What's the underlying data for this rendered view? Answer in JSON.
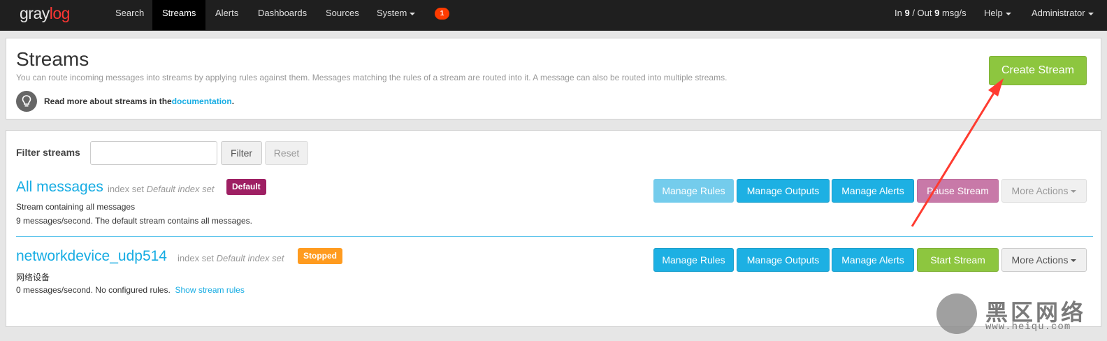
{
  "navbar": {
    "logo": {
      "part1": "gray",
      "part2": "log"
    },
    "items": [
      "Search",
      "Streams",
      "Alerts",
      "Dashboards",
      "Sources",
      "System"
    ],
    "notification_count": "1",
    "throughput": {
      "prefix": "In ",
      "in_value": "9",
      "mid": " / Out ",
      "out_value": "9",
      "suffix": " msg/s"
    },
    "help": "Help",
    "user": "Administrator"
  },
  "header": {
    "title": "Streams",
    "description": "You can route incoming messages into streams by applying rules against them. Messages matching the rules of a stream are routed into it. A message can also be routed into multiple streams.",
    "doc_hint_prefix": "Read more about streams in the ",
    "doc_link": "documentation",
    "doc_hint_suffix": ".",
    "create_button": "Create Stream"
  },
  "filter": {
    "label": "Filter streams",
    "value": "",
    "filter_button": "Filter",
    "reset_button": "Reset"
  },
  "streams": [
    {
      "title": "All messages",
      "index_prefix": "index set ",
      "index_set": "Default index set",
      "badge": "Default",
      "description": "Stream containing all messages",
      "stats": "9 messages/second. The default stream contains all messages.",
      "actions": [
        "Manage Rules",
        "Manage Outputs",
        "Manage Alerts",
        "Pause Stream",
        "More Actions"
      ]
    },
    {
      "title": "networkdevice_udp514",
      "index_prefix": "index set ",
      "index_set": "Default index set",
      "badge": "Stopped",
      "description": "网络设备",
      "stats": "0 messages/second. No configured rules.",
      "show_rules_link": "Show stream rules",
      "actions": [
        "Manage Rules",
        "Manage Outputs",
        "Manage Alerts",
        "Start Stream",
        "More Actions"
      ]
    }
  ],
  "watermark": {
    "name": "黑区网络",
    "url": "www.heiqu.com"
  },
  "colors": {
    "navbar_bg": "#1f1f1f",
    "link": "#16ace3",
    "primary": "#1db0e3",
    "success": "#8dc63f",
    "default_badge": "#9e1f63",
    "stopped_badge": "#ff9b1f",
    "annotation_arrow": "#ff3b30"
  }
}
